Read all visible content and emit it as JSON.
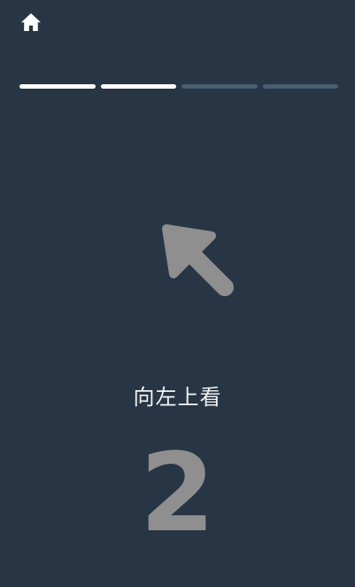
{
  "app": {
    "background_color": "#273544"
  },
  "header": {
    "home_icon": "home-icon",
    "home_color": "#ffffff"
  },
  "progress": {
    "current_step": 2,
    "total_steps": 4,
    "active_color": "#ffffff",
    "inactive_color": "#4a5e72"
  },
  "prompt": {
    "direction_icon": "arrow-up-left-icon",
    "arrow_color": "#8f8f8f",
    "instruction": "向左上看",
    "countdown": "2"
  }
}
